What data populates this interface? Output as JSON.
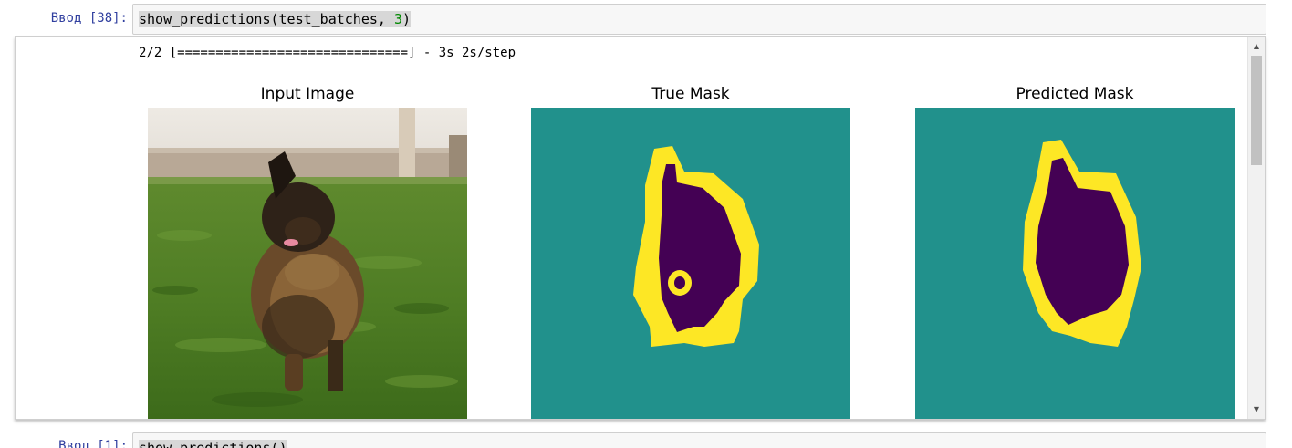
{
  "cells": {
    "cell1": {
      "prompt": "Ввод [38]:",
      "code_fn": "show_predictions(test_batches, ",
      "code_arg": "3",
      "code_end": ")"
    },
    "cell2": {
      "prompt": "Ввод [1]:",
      "code": "show_predictions()"
    }
  },
  "output": {
    "progress_text": "2/2 [==============================] - 3s 2s/step",
    "panels": [
      {
        "title": "Input Image"
      },
      {
        "title": "True Mask"
      },
      {
        "title": "Predicted Mask"
      }
    ]
  },
  "colors": {
    "mask_background": "#21918c",
    "mask_border": "#fde725",
    "mask_object": "#440154",
    "prompt": "#303f9f",
    "number_literal": "#008800"
  },
  "icons": {
    "scroll_up": "triangle-up-icon",
    "scroll_down": "triangle-down-icon"
  }
}
